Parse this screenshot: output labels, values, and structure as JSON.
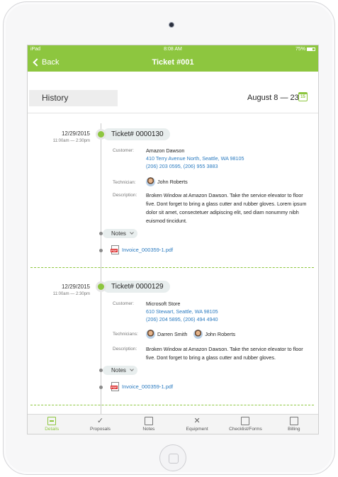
{
  "status": {
    "device": "iPad",
    "time": "8:08 AM",
    "battery": "75%"
  },
  "nav": {
    "back_label": "Back",
    "title": "Ticket #001"
  },
  "header": {
    "history_label": "History",
    "date_range": "August 8 — 23",
    "calendar_day": "15"
  },
  "tickets": [
    {
      "date": "12/29/2015",
      "time": "11:00am — 2:30pm",
      "ticket_no": "Ticket# 0000130",
      "customer_label": "Customer:",
      "customer_name": "Amazon Dawson",
      "address": "410 Terry Avenue North, Seattle, WA 98105",
      "phones": "(206) 203 0595, (206) 955 3883",
      "technician_label": "Technician:",
      "technicians": [
        "John Roberts"
      ],
      "description_label": "Description:",
      "description": "Broken Window at Amazon Dawson. Take the service elevator to floor five. Dont forget to bring a glass cutter and rubber gloves. Lorem ipsum dolor sit amet, consectetuer adipiscing elit, sed diam nonummy nibh euismod tincidunt.",
      "notes_label": "Notes",
      "attachment": "Invoice_000359-1.pdf"
    },
    {
      "date": "12/29/2015",
      "time": "11:00am — 2:30pm",
      "ticket_no": "Ticket# 0000129",
      "customer_label": "Customer:",
      "customer_name": "Microsoft Store",
      "address": "610 Stewart, Seattle, WA 98105",
      "phones": "(206) 204 5895, (206) 494 4940",
      "technician_label": "Technicians:",
      "technicians": [
        "Darren Smith",
        "John Roberts"
      ],
      "description_label": "Description:",
      "description": "Broken Window at Amazon Dawson. Take the service elevator to floor five. Dont forget to bring a glass cutter and rubber gloves.",
      "notes_label": "Notes",
      "attachment": "Invoice_000359-1.pdf"
    }
  ],
  "tabs": [
    "Details",
    "Proposals",
    "Notes",
    "Equipment",
    "Checklist/Forms",
    "Billing"
  ],
  "colors": {
    "accent": "#8dc63f",
    "link": "#2b7bc0"
  }
}
